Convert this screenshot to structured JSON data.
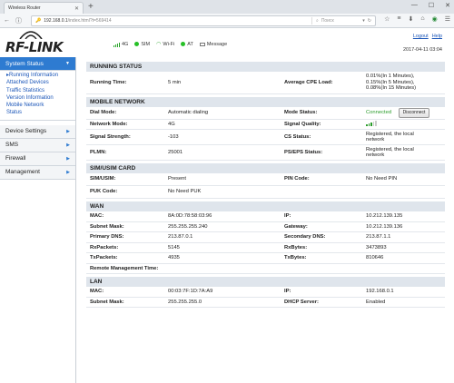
{
  "browser": {
    "tab_title": "Wireless Router",
    "url_main": "192.168.0.1",
    "url_rest": "/index.html?t=569414",
    "search_placeholder": "Поиск"
  },
  "header": {
    "logo": "RF-LINK",
    "status": {
      "network": "4G",
      "sim": "SIM",
      "wifi": "Wi-Fi",
      "at": "AT",
      "message": "Message"
    },
    "logout": "Logout",
    "help": "Help",
    "datetime": "2017-04-11 03:04"
  },
  "sidebar": {
    "system_status": "System Status",
    "submenu": [
      "Running Information",
      "Attached Devices",
      "Traffic Statistics",
      "Version Information",
      "Mobile Network",
      "Status"
    ],
    "device_settings": "Device Settings",
    "sms": "SMS",
    "firewall": "Firewall",
    "management": "Management"
  },
  "running": {
    "title": "RUNNING STATUS",
    "running_time_label": "Running Time:",
    "running_time": "5 min",
    "cpe_load_label": "Average CPE Load:",
    "cpe_load_1": "0.01%(In 1 Minutes),",
    "cpe_load_2": "0.15%(In 5 Minutes),",
    "cpe_load_3": "0.08%(In 15 Minutes)"
  },
  "mobile": {
    "title": "MOBILE NETWORK",
    "dial_mode_label": "Dial Mode:",
    "dial_mode": "Automatic dialing",
    "mode_status_label": "Mode Status:",
    "mode_status": "Connected",
    "disconnect": "Disconnect",
    "network_mode_label": "Network Mode:",
    "network_mode": "4G",
    "signal_quality_label": "Signal Quality:",
    "signal_strength_label": "Signal Strength:",
    "signal_strength": "-103",
    "cs_status_label": "CS Status:",
    "cs_status_1": "Registered, the local",
    "cs_status_2": "network",
    "plmn_label": "PLMN:",
    "plmn": "25001",
    "ps_eps_label": "PS/EPS Status:",
    "ps_eps_1": "Registered, the local",
    "ps_eps_2": "network"
  },
  "sim": {
    "title": "SIM/USIM CARD",
    "sim_label": "SIM/USIM:",
    "sim": "Present",
    "pin_label": "PIN Code:",
    "pin": "No Need PIN",
    "puk_label": "PUK Code:",
    "puk": "No Need PUK"
  },
  "wan": {
    "title": "WAN",
    "mac_label": "MAC:",
    "mac": "8A:0D:78:58:03:96",
    "ip_label": "IP:",
    "ip": "10.212.139.135",
    "subnet_label": "Subnet Mask:",
    "subnet": "255.255.255.240",
    "gateway_label": "Gateway:",
    "gateway": "10.212.139.136",
    "pdns_label": "Primary DNS:",
    "pdns": "213.87.0.1",
    "sdns_label": "Secondary DNS:",
    "sdns": "213.87.1.1",
    "rxp_label": "RxPackets:",
    "rxp": "5145",
    "rxb_label": "RxBytes:",
    "rxb": "3473893",
    "txp_label": "TxPackets:",
    "txp": "4935",
    "txb_label": "TxBytes:",
    "txb": "810646",
    "remote_label": "Remote Management Time:"
  },
  "lan": {
    "title": "LAN",
    "mac_label": "MAC:",
    "mac": "00:03:7F:1D:7A:A9",
    "ip_label": "IP:",
    "ip": "192.168.0.1",
    "subnet_label": "Subnet Mask:",
    "subnet": "255.255.255.0",
    "dhcp_label": "DHCP Server:",
    "dhcp": "Enabled"
  }
}
